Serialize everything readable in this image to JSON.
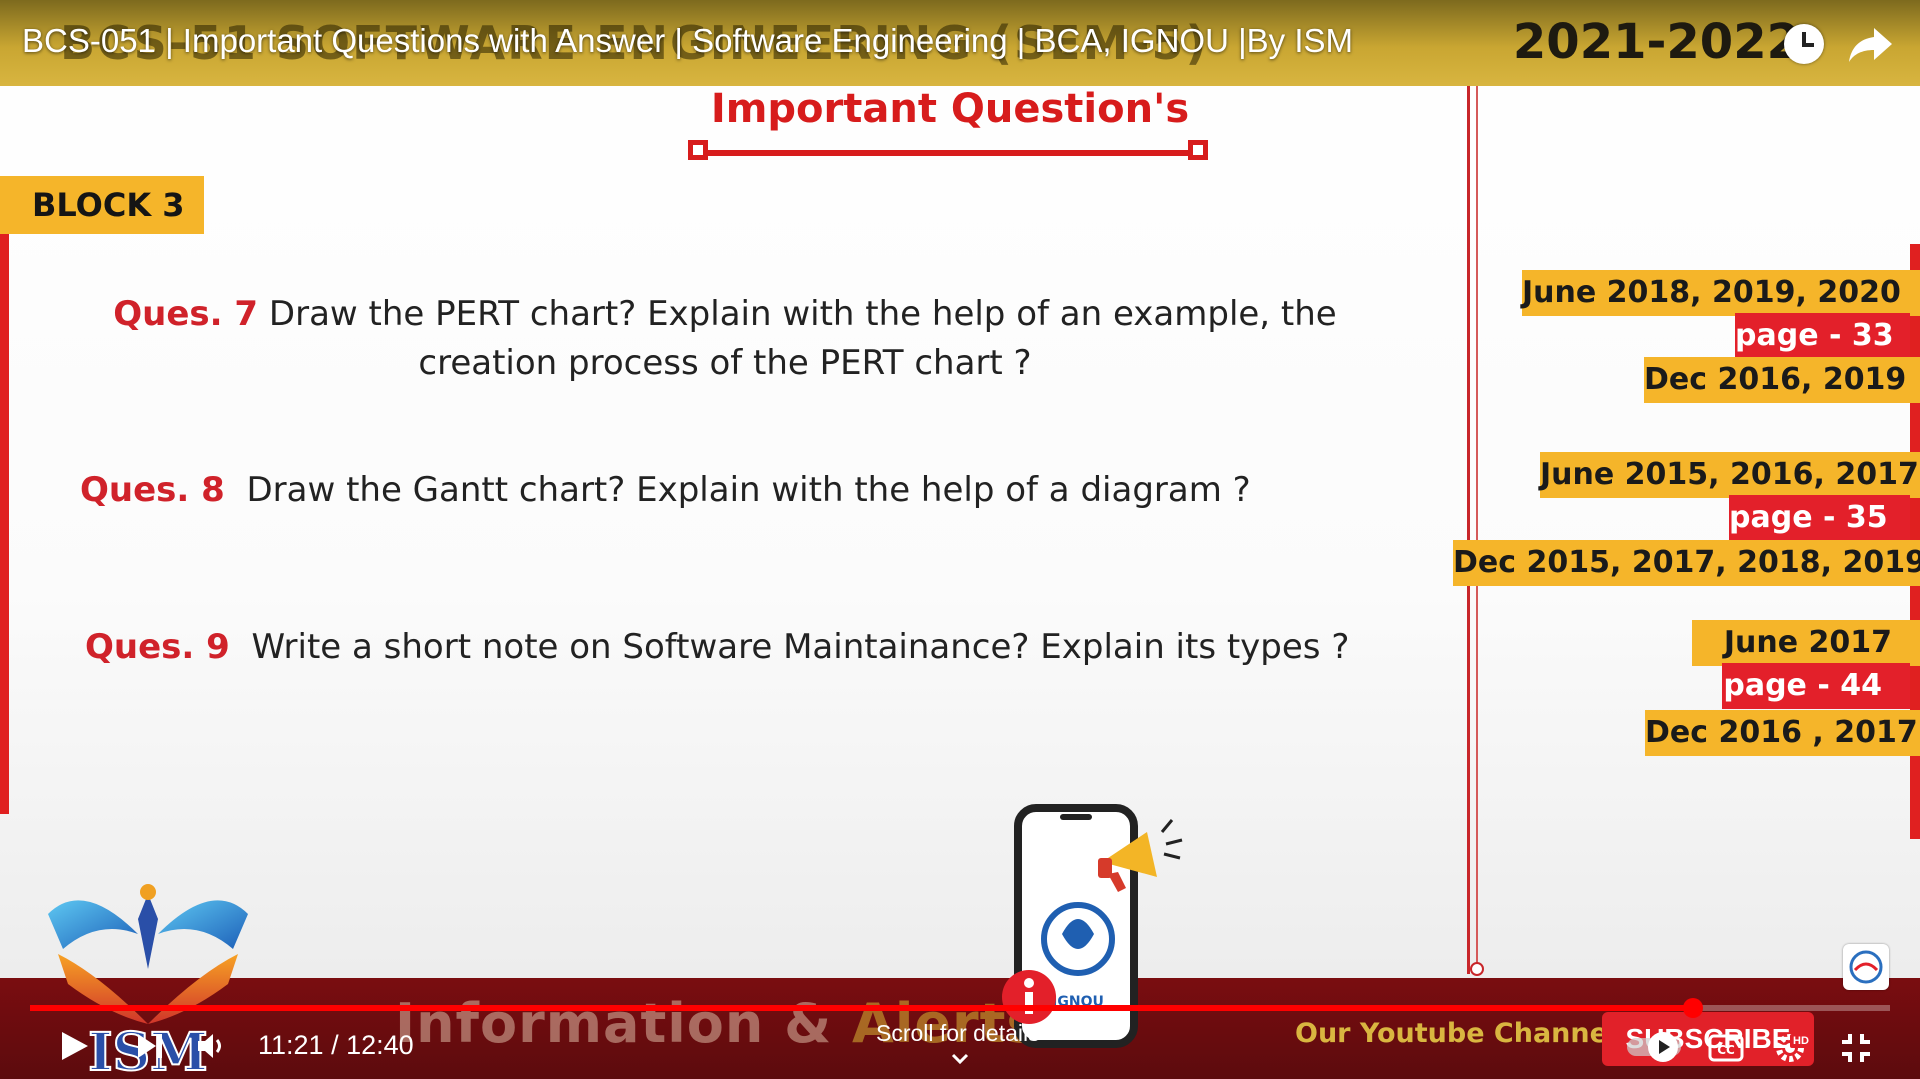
{
  "video": {
    "title": "BCS-051 | Important Questions with Answer | Software Engineering | BCA, IGNOU |By ISM",
    "background_title": "BCS-51 SOFTWARE ENGINEERING (SEM-5)",
    "year": "2021-2022"
  },
  "slide": {
    "heading": "Important Question's",
    "block": "BLOCK 3",
    "questions": [
      {
        "label": "Ques. 7",
        "text": "Draw the PERT chart? Explain with the help of an example, the creation process of the PERT chart ?"
      },
      {
        "label": "Ques. 8",
        "text": "Draw the Gantt chart? Explain with the help of a diagram ?"
      },
      {
        "label": "Ques. 9",
        "text": "Write a short note on Software Maintainance? Explain its types ?"
      }
    ],
    "tags": [
      {
        "june": "June 2018, 2019, 2020",
        "page": "page - 33",
        "dec": "Dec 2016, 2019"
      },
      {
        "june": "June 2015, 2016, 2017",
        "page": "page - 35",
        "dec": "Dec 2015, 2017, 2018, 2019"
      },
      {
        "june": "June 2017",
        "page": "page - 44",
        "dec": "Dec 2016 , 2017"
      }
    ],
    "logo_text": "ISM",
    "phone_label": "IGNOU",
    "banner_info": "Information & ",
    "banner_alerts": "Alerts",
    "channel_label": "Our Youtube Channel",
    "subscribe_label": "SUBSCRIBE"
  },
  "player": {
    "current_time": "11:21",
    "duration": "12:40",
    "time_display": "11:21 / 12:40",
    "progress": 0.894,
    "scroll_hint": "Scroll for details",
    "hd_badge": "HD",
    "icons": [
      "play-icon",
      "next-icon",
      "volume-icon",
      "autoplay-toggle-icon",
      "captions-icon",
      "settings-icon",
      "exit-fullscreen-icon",
      "clock-icon",
      "share-icon",
      "chevron-down-icon",
      "info-icon"
    ],
    "colors": {
      "accent": "#ff0000",
      "gold": "#f5b52a",
      "red": "#e3202a"
    }
  }
}
